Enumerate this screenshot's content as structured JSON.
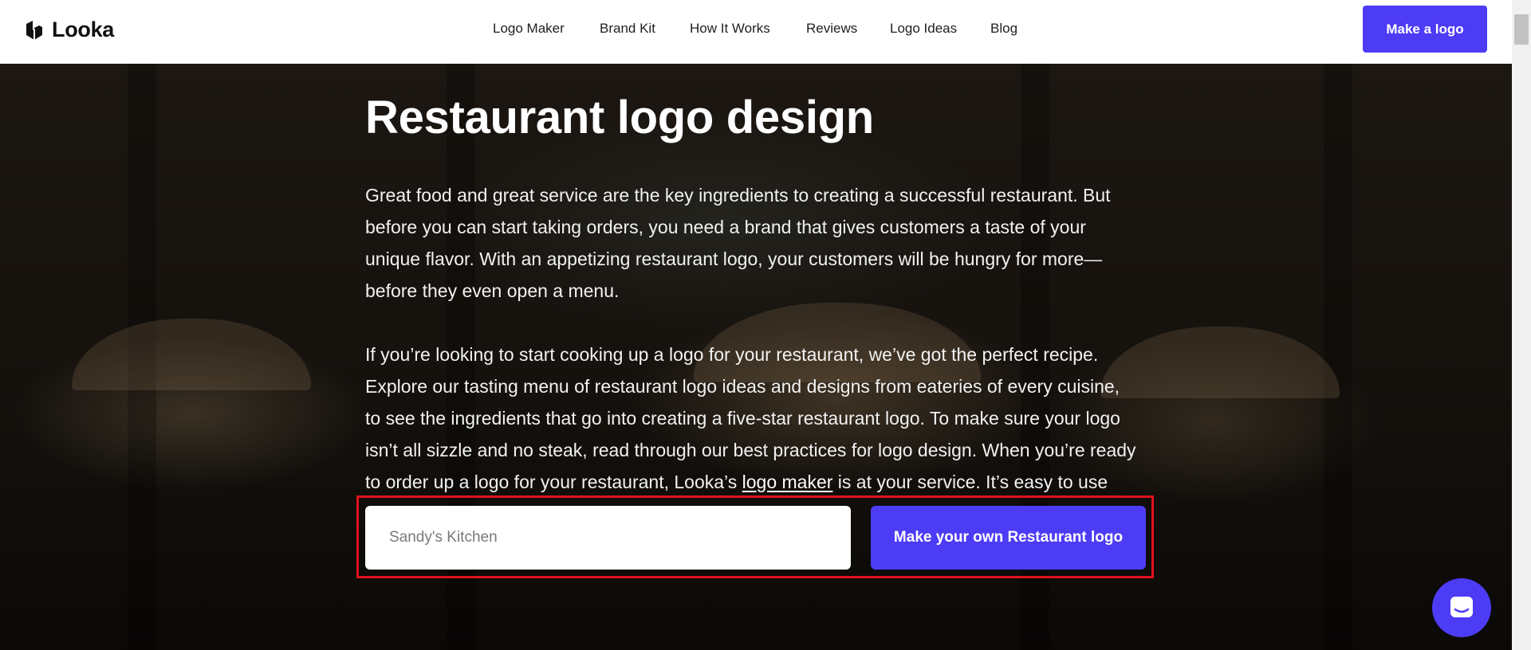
{
  "brand": {
    "name": "Looka",
    "accent": "#4d3cf6"
  },
  "nav": {
    "links": [
      "Logo Maker",
      "Brand Kit",
      "How It Works",
      "Reviews",
      "Logo Ideas",
      "Blog"
    ],
    "cta": "Make a logo"
  },
  "hero": {
    "title": "Restaurant logo design",
    "paragraph1": "Great food and great service are the key ingredients to creating a successful restaurant. But before you can start taking orders, you need a brand that gives customers a taste of your unique flavor. With an appetizing restaurant logo, your customers will be hungry for more—before they even open a menu.",
    "paragraph2_before": "If you’re looking to start cooking up a logo for your restaurant, we’ve got the perfect recipe. Explore our tasting menu of restaurant logo ideas and designs from eateries of every cuisine, to see the ingredients that go into creating a five-star restaurant logo. To make sure your logo isn’t all sizzle and no steak, read through our best practices for logo design. When you’re ready to order up a logo for your restaurant, Looka’s ",
    "paragraph2_link": "logo maker",
    "paragraph2_after": " is at your service. It’s easy to use and free to try—no reservations necessary.",
    "input_placeholder": "Sandy's Kitchen",
    "cta": "Make your own Restaurant logo"
  },
  "icons": {
    "logo": "looka-logo-icon",
    "chat": "chat-icon"
  },
  "colors": {
    "highlight_border": "#e0111d",
    "hero_text": "#ffffff"
  }
}
